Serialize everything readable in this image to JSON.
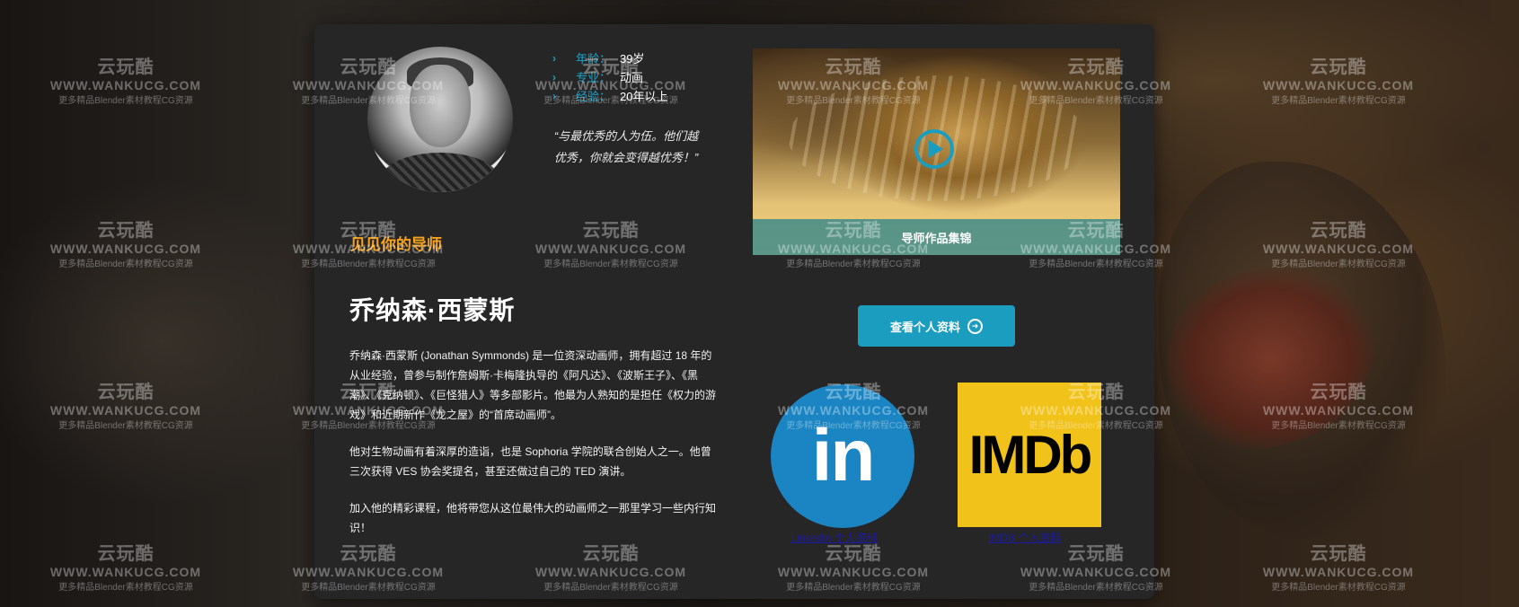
{
  "watermark": {
    "logo": "云玩酷",
    "site": "WWW.WANKUCG.COM",
    "tagline": "更多精品Blender素材教程CG资源"
  },
  "mentor": {
    "avatar_icon": "mentor-portrait",
    "stats": [
      {
        "label": "年龄：",
        "value": "39岁"
      },
      {
        "label": "专业：",
        "value": "动画"
      },
      {
        "label": "经验：",
        "value": "20年以上"
      }
    ],
    "quote": "“与最优秀的人为伍。他们越优秀，你就会变得越优秀！”",
    "section_tag": "见见你的导师",
    "name": "乔纳森·西蒙斯",
    "bio": [
      "乔纳森·西蒙斯 (Jonathan Symmonds) 是一位资深动画师，拥有超过 18 年的从业经验，曾参与制作詹姆斯·卡梅隆执导的《阿凡达》、《波斯王子》、《黑潮》、《克纳顿》、《巨怪猎人》等多部影片。他最为人熟知的是担任《权力的游戏》和近期新作《龙之屋》的“首席动画师”。",
      "他对生物动画有着深厚的造诣，也是 Sophoria 学院的联合创始人之一。他曾三次获得 VES 协会奖提名，甚至还做过自己的 TED 演讲。",
      "加入他的精彩课程，他将带您从这位最伟大的动画师之一那里学习一些内行知识！"
    ]
  },
  "video": {
    "caption": "导师作品集锦",
    "play_icon": "play-icon"
  },
  "profile_button": {
    "label": "查看个人资料",
    "icon": "arrow-circle-right-icon"
  },
  "social": {
    "linkedin_logo": "in",
    "linkedin_caption": "LinkedIn 个人资料",
    "imdb_logo": "IMDb",
    "imdb_caption": "IMDB 个人资料"
  },
  "colors": {
    "accent": "#1b9dbf",
    "tag": "#f6a21b",
    "card": "#262627",
    "linkedin": "#1a85c2",
    "imdb": "#f1c21a"
  }
}
